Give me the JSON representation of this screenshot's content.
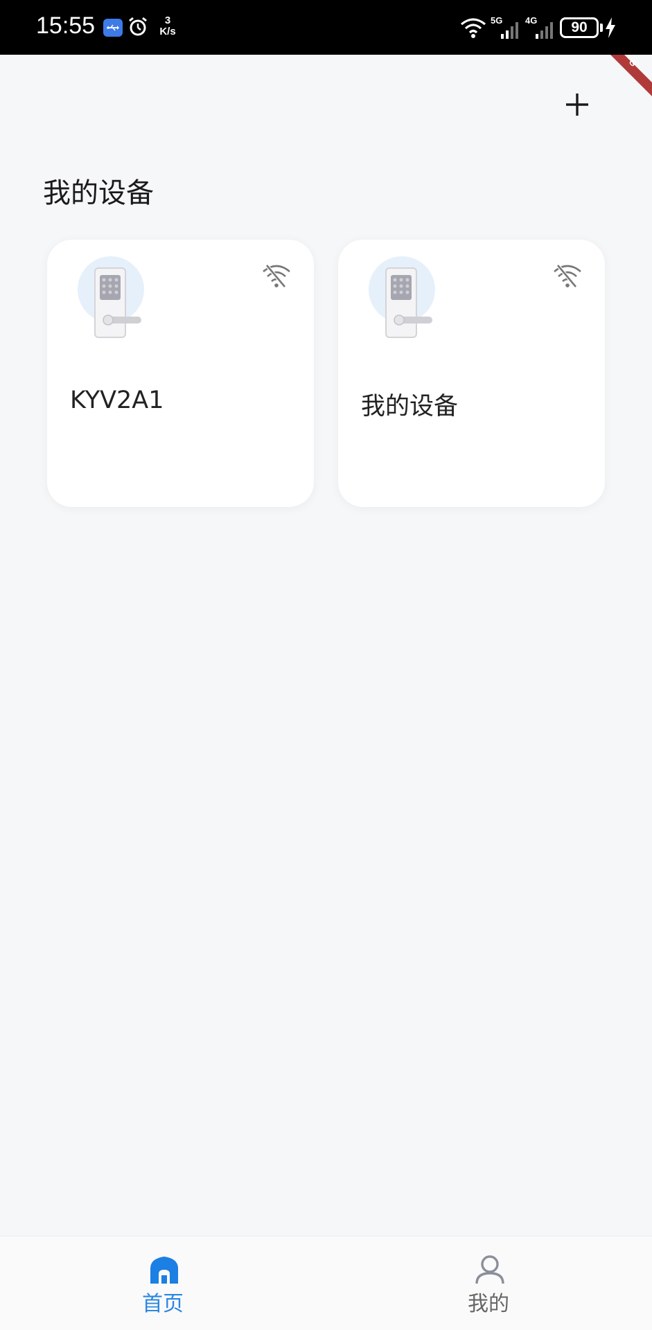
{
  "status_bar": {
    "time": "15:55",
    "usb_icon": "usb-icon",
    "alarm_icon": "alarm-icon",
    "net_speed_value": "3",
    "net_speed_unit": "K/s",
    "wifi_icon": "wifi-icon",
    "signal_1_label": "5G",
    "signal_2_label": "4G",
    "battery_level": "90",
    "charging_icon": "charging-icon"
  },
  "header": {
    "add_icon": "plus-icon",
    "title": "我的设备"
  },
  "devices": [
    {
      "name": "KYV2A1",
      "image": "door-lock-image",
      "status_icon": "wifi-offline-icon"
    },
    {
      "name": "我的设备",
      "image": "door-lock-image",
      "status_icon": "wifi-offline-icon"
    }
  ],
  "bottom_nav": {
    "items": [
      {
        "label": "首页",
        "icon": "home-icon",
        "active": true
      },
      {
        "label": "我的",
        "icon": "user-icon",
        "active": false
      }
    ]
  },
  "colors": {
    "background": "#f6f7f9",
    "accent": "#2a86e0",
    "debug_ribbon": "#c0392b"
  }
}
